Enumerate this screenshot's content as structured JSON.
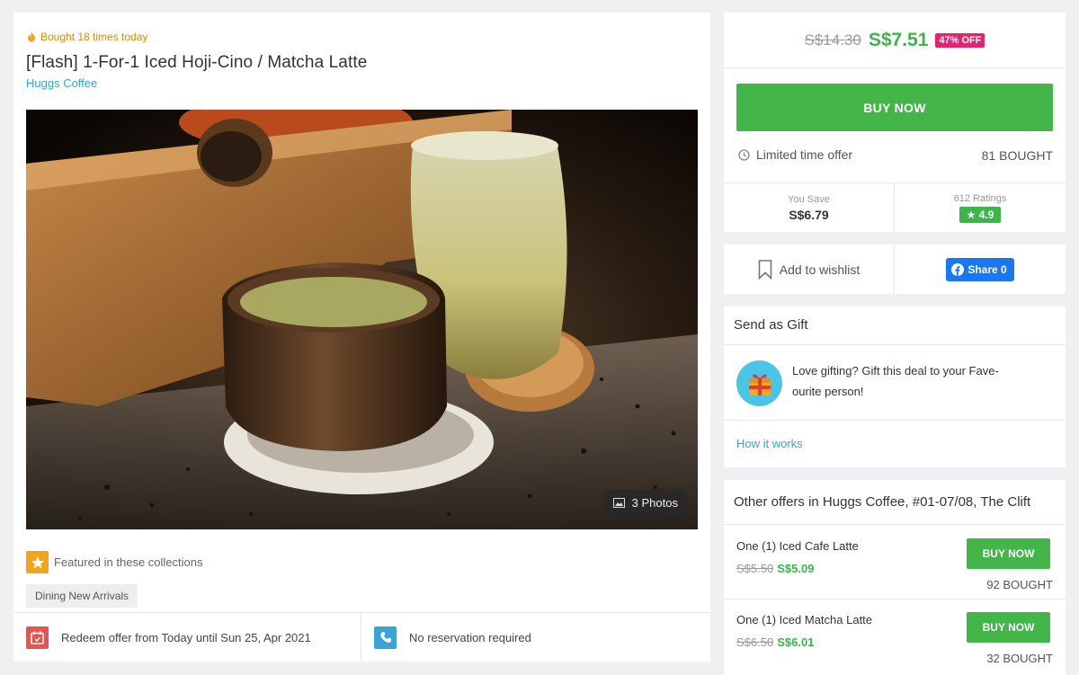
{
  "deal": {
    "bought_today": "Bought 18 times today",
    "title": "[Flash] 1-For-1 Iced Hoji-Cino / Matcha Latte",
    "merchant": "Huggs Coffee",
    "photos_label": "3 Photos",
    "featured_label": "Featured in these collections",
    "collection_tag": "Dining New Arrivals",
    "redeem_text": "Redeem offer from Today until Sun 25, Apr 2021",
    "reservation_text": "No reservation required"
  },
  "purchase": {
    "old_price": "S$14.30",
    "new_price": "S$7.51",
    "discount_badge": "47% OFF",
    "buy_now_label": "BUY NOW",
    "limited_label": "Limited time offer",
    "bought_count": "81 BOUGHT",
    "you_save_label": "You Save",
    "you_save_value": "S$6.79",
    "ratings_label": "612 Ratings",
    "rating_value": "★ 4.9"
  },
  "social": {
    "wishlist_label": "Add to wishlist",
    "share_label": "Share 0"
  },
  "gift": {
    "title": "Send as Gift",
    "text_line1": "Love gifting? Gift this deal to your Fave-",
    "text_line2": "ourite person!",
    "how_it_works": "How it works"
  },
  "other_offers": {
    "title": "Other offers in Huggs Coffee, #01-07/08, The Clift",
    "items": [
      {
        "name": "One (1) Iced Cafe Latte",
        "old_price": "S$5.50",
        "new_price": "S$5.09",
        "button": "BUY NOW",
        "bought": "92 BOUGHT"
      },
      {
        "name": "One (1) Iced Matcha Latte",
        "old_price": "S$6.50",
        "new_price": "S$6.01",
        "button": "BUY NOW",
        "bought": "32 BOUGHT"
      }
    ]
  },
  "colors": {
    "brand_green": "#43b549",
    "link_blue": "#35a7d6",
    "discount_pink": "#e6236f",
    "facebook_blue": "#1877f2"
  },
  "icons": [
    "fire-icon",
    "image-icon",
    "star-icon",
    "calendar-icon",
    "phone-icon",
    "clock-icon",
    "bookmark-icon",
    "facebook-icon",
    "gift-icon"
  ]
}
